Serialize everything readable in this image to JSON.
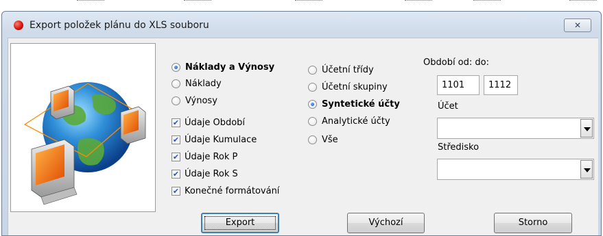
{
  "window": {
    "title": "Export položek plánu do XLS souboru",
    "close_glyph": "✕",
    "app_icon": "red-ball-icon"
  },
  "picture": {
    "icon": "network-globe-icon"
  },
  "data_type_radios": [
    {
      "label": "Náklady a Výnosy",
      "checked": true
    },
    {
      "label": "Náklady",
      "checked": false
    },
    {
      "label": "Výnosy",
      "checked": false
    }
  ],
  "data_checkboxes": [
    {
      "label": "Údaje Období",
      "checked": true
    },
    {
      "label": "Údaje Kumulace",
      "checked": true
    },
    {
      "label": "Údaje Rok P",
      "checked": true
    },
    {
      "label": "Údaje Rok S",
      "checked": true
    },
    {
      "label": "Konečné formátování",
      "checked": true
    }
  ],
  "level_radios": [
    {
      "label": "Účetní třídy",
      "checked": false
    },
    {
      "label": "Účetní skupiny",
      "checked": false
    },
    {
      "label": "Syntetické účty",
      "checked": true
    },
    {
      "label": "Analytické účty",
      "checked": false
    },
    {
      "label": "Vše",
      "checked": false
    }
  ],
  "period": {
    "label": "Období od: do:",
    "from": "1101",
    "to": "1112"
  },
  "account": {
    "label": "Účet",
    "value": ""
  },
  "center": {
    "label": "Středisko",
    "value": ""
  },
  "buttons": {
    "export": "Export",
    "default": "Výchozí",
    "cancel": "Storno"
  },
  "colors": {
    "check_mark": "#2b56c4",
    "radio_dot": "#0f4fb8",
    "default_button_border": "#3c7fb1"
  }
}
